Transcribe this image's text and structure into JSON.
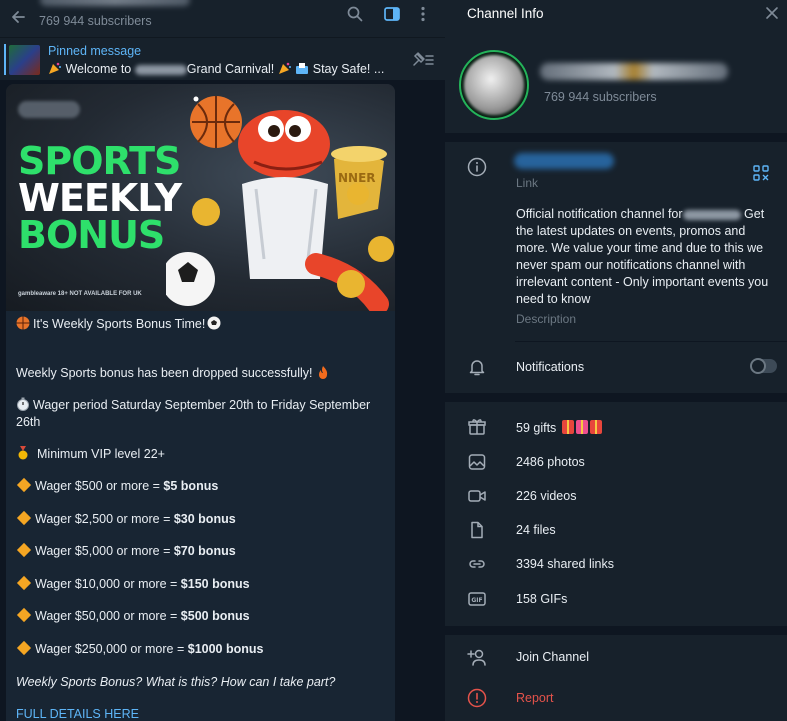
{
  "chat": {
    "header": {
      "subscribers": "769 944 subscribers"
    },
    "pinned": {
      "title": "Pinned message",
      "text_before": "Welcome to",
      "text_after": "Grand Carnival!",
      "text_tail": "Stay Safe! ..."
    },
    "banner": {
      "line1": "SPORTS",
      "line2": "WEEKLY",
      "line3": "BONUS",
      "footer": "gambleaware 18+ NOT AVAILABLE FOR UK",
      "trophy_text": "NNER"
    },
    "caption": {
      "headline": "It's Weekly Sports Bonus Time!",
      "dropped": "Weekly Sports bonus has been dropped successfully!",
      "wager_period": "Wager period Saturday September 20th to Friday September 26th",
      "min_vip": "Minimum VIP level 22+",
      "tiers": [
        {
          "text": "Wager $500 or more = ",
          "bonus": "$5 bonus"
        },
        {
          "text": "Wager $2,500 or more = ",
          "bonus": "$30 bonus"
        },
        {
          "text": "Wager $5,000 or more = ",
          "bonus": "$70 bonus"
        },
        {
          "text": "Wager $10,000 or more = ",
          "bonus": "$150 bonus"
        },
        {
          "text": "Wager $50,000 or more = ",
          "bonus": "$500 bonus"
        },
        {
          "text": "Wager $250,000 or more = ",
          "bonus": "$1000 bonus"
        }
      ],
      "question": "Weekly Sports Bonus? What is this? How can I take part?",
      "link": "FULL DETAILS HERE"
    }
  },
  "info": {
    "title": "Channel Info",
    "subscribers": "769 944 subscribers",
    "link_label": "Link",
    "description_before": "Official notification channel for",
    "description_after": "Get the latest updates on events, promos and more. We value your time and due to this we never spam our notifications channel with irrelevant content - Only important events you need to know",
    "description_label": "Description",
    "notifications": "Notifications",
    "notifications_on": false,
    "media": {
      "gifts": "59 gifts",
      "photos": "2486 photos",
      "videos": "226 videos",
      "files": "24 files",
      "links": "3394 shared links",
      "gifs": "158 GIFs"
    },
    "join": "Join Channel",
    "report": "Report"
  },
  "colors": {
    "accent": "#5eb5f7",
    "report": "#e5534b",
    "banner_green": "#2ee06b"
  }
}
